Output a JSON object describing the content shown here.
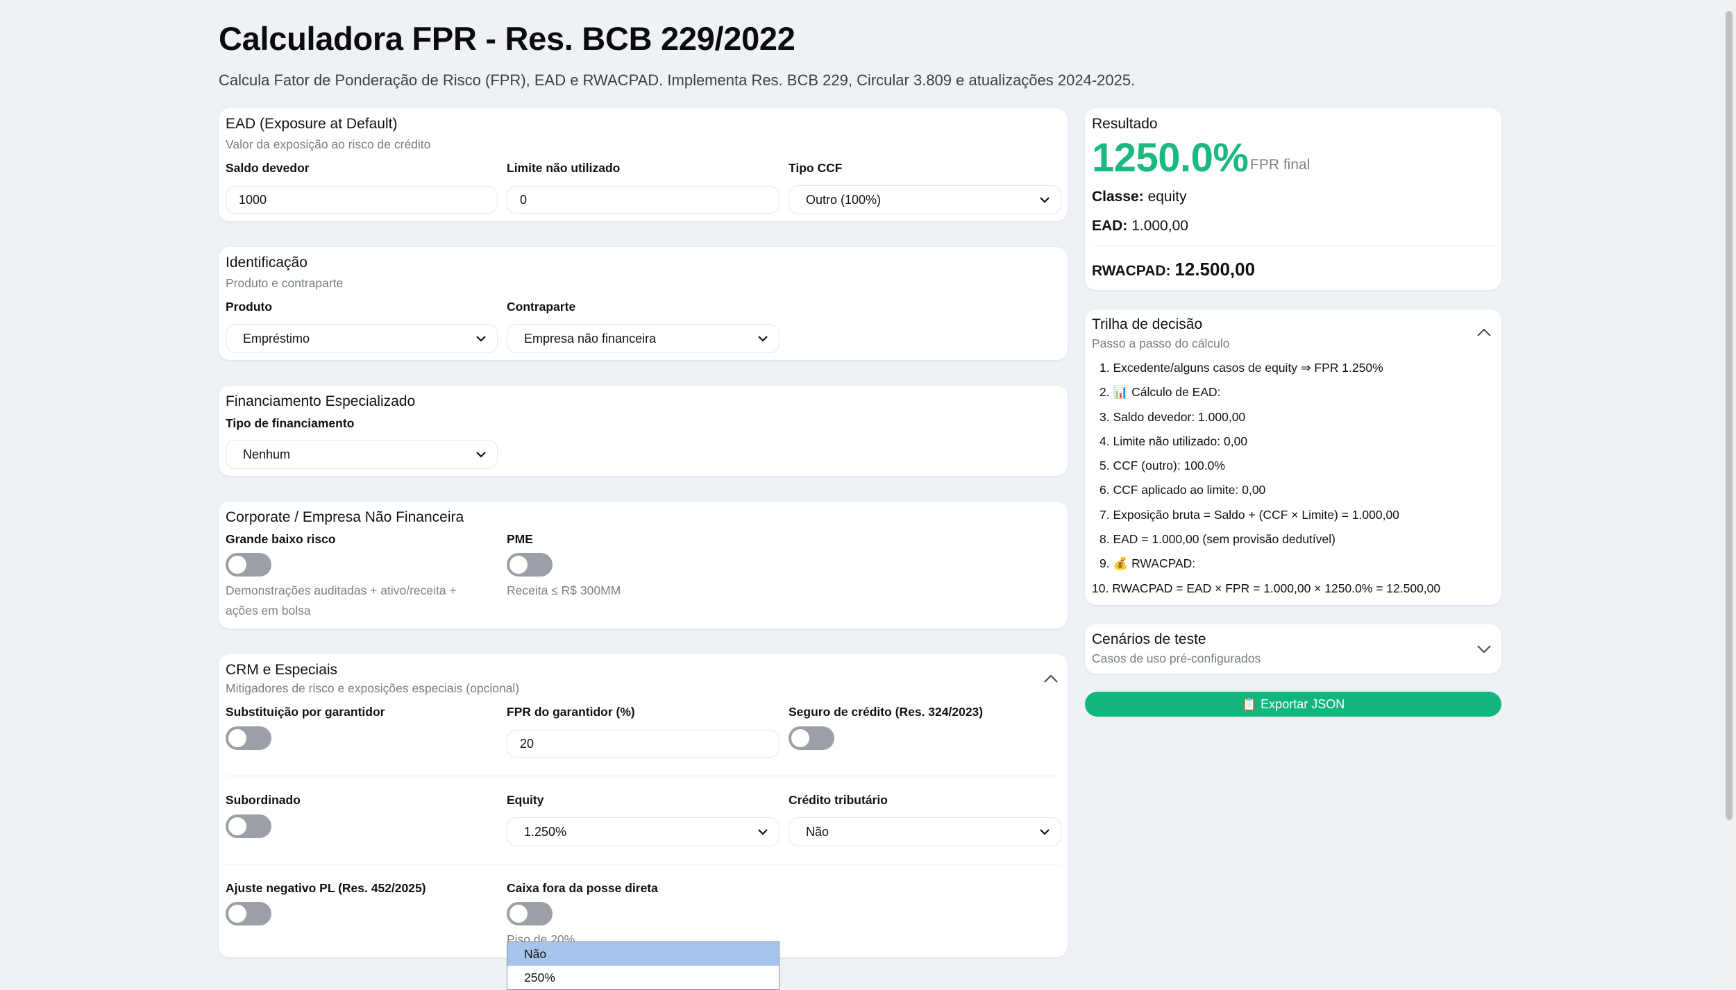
{
  "header": {
    "title": "Calculadora FPR - Res. BCB 229/2022",
    "subtitle": "Calcula Fator de Ponderação de Risco (FPR), EAD e RWACPAD. Implementa Res. BCB 229, Circular 3.809 e atualizações 2024-2025."
  },
  "ead": {
    "title": "EAD (Exposure at Default)",
    "desc": "Valor da exposição ao risco de crédito",
    "saldo_label": "Saldo devedor",
    "saldo_value": "1000",
    "limite_label": "Limite não utilizado",
    "limite_value": "0",
    "ccf_label": "Tipo CCF",
    "ccf_value": "Outro (100%)"
  },
  "identificacao": {
    "title": "Identificação",
    "desc": "Produto e contraparte",
    "produto_label": "Produto",
    "produto_value": "Empréstimo",
    "contraparte_label": "Contraparte",
    "contraparte_value": "Empresa não financeira"
  },
  "financiamento": {
    "title": "Financiamento Especializado",
    "tipo_label": "Tipo de financiamento",
    "tipo_value": "Nenhum"
  },
  "corporate": {
    "title": "Corporate / Empresa Não Financeira",
    "grande_label": "Grande baixo risco",
    "grande_on": false,
    "grande_hint_1": "Demonstrações auditadas + ativo/receita +",
    "grande_hint_2": "ações em bolsa",
    "pme_label": "PME",
    "pme_on": false,
    "pme_hint": "Receita ≤ R$ 300MM"
  },
  "crm": {
    "title": "CRM e Especiais",
    "desc": "Mitigadores de risco e exposições especiais (opcional)",
    "subst_label": "Substituição por garantidor",
    "subst_on": false,
    "fpr_gar_label": "FPR do garantidor (%)",
    "fpr_gar_value": "20",
    "seguro_label": "Seguro de crédito (Res. 324/2023)",
    "seguro_on": false,
    "subordinado_label": "Subordinado",
    "subordinado_on": false,
    "equity_label": "Equity",
    "equity_value": "1.250%",
    "credito_label": "Crédito tributário",
    "credito_value": "Não",
    "ajuste_label": "Ajuste negativo PL (Res. 452/2025)",
    "ajuste_on": false,
    "caixa_label": "Caixa fora da posse direta",
    "caixa_on": false,
    "caixa_hint": "Piso de 20%"
  },
  "dropdown": {
    "options": [
      "Não",
      "250%"
    ],
    "selected": "Não"
  },
  "resultado": {
    "title": "Resultado",
    "fpr_value": "1250.0%",
    "fpr_caption": "FPR final",
    "classe_label": "Classe:",
    "classe_value": "equity",
    "ead_label": "EAD:",
    "ead_value": "1.000,00",
    "rwacpad_label": "RWACPAD:",
    "rwacpad_value": "12.500,00"
  },
  "trilha": {
    "title": "Trilha de decisão",
    "desc": "Passo a passo do cálculo",
    "steps": [
      "1. Excedente/alguns casos de equity ⇒ FPR 1.250%",
      "2. 📊 Cálculo de EAD:",
      "3. Saldo devedor: 1.000,00",
      "4. Limite não utilizado: 0,00",
      "5. CCF (outro): 100.0%",
      "6. CCF aplicado ao limite: 0,00",
      "7. Exposição bruta = Saldo + (CCF × Limite) = 1.000,00",
      "8. EAD = 1.000,00 (sem provisão dedutível)",
      "9. 💰 RWACPAD:",
      "10. RWACPAD = EAD × FPR = 1.000,00 × 1250.0% = 12.500,00"
    ]
  },
  "cenarios": {
    "title": "Cenários de teste",
    "desc": "Casos de uso pré-configurados"
  },
  "export": {
    "label": "📋 Exportar JSON"
  },
  "colors": {
    "accent": "#19b97f",
    "button": "#12b67c",
    "toggle_off": "#9aa0a6",
    "dropdown_selected": "#a7c3ec"
  }
}
